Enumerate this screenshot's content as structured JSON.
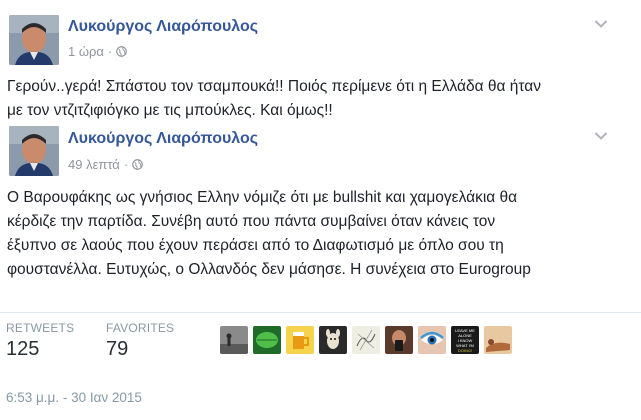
{
  "posts": [
    {
      "author": "Λυκούργος Λιαρόπουλος",
      "time": "1 ώρα",
      "separator": "·",
      "text_lines": [
        "Γερούν..γερά! Σπάστου τον τσαμπουκά!! Ποιός περίμενε ότι η Ελλάδα θα ήταν",
        "με τον ντζιτζιφιόγκο με τις μπούκλες. Και όμως!!"
      ]
    },
    {
      "author": "Λυκούργος Λιαρόπουλος",
      "time": "49 λεπτά",
      "separator": "·",
      "text_lines": [
        "Ο Βαρουφάκης ως γνήσιος Ελλην νόμιζε ότι με bullshit και χαμογελάκια θα",
        "κέρδιζε την παρτίδα. Συνέβη αυτό που πάντα συμβαίνει όταν κάνεις τον",
        "έξυπνο σε λαούς που έχουν περάσει από το Διαφωτισμό με όπλο σου τη",
        "φουστανέλλα. Ευτυχώς, ο Ολλανδός δεν μάσησε. Η συνέχεια στο Eurogroup"
      ]
    }
  ],
  "stats": {
    "retweets_label": "RETWEETS",
    "retweets_value": "125",
    "favorites_label": "FAVORITES",
    "favorites_value": "79"
  },
  "favoriters": [
    {
      "icon": "avatar-silhouette-fog",
      "color": "#6b6b6b"
    },
    {
      "icon": "avatar-green-leaf",
      "color": "#2f8a3a"
    },
    {
      "icon": "avatar-beer-mug",
      "color": "#e0a21c"
    },
    {
      "icon": "avatar-llama",
      "color": "#3a3a3a"
    },
    {
      "icon": "avatar-sketch",
      "color": "#d8d8c8"
    },
    {
      "icon": "avatar-phone-photo",
      "color": "#6a3b2a"
    },
    {
      "icon": "avatar-eye-makeup",
      "color": "#2a6fb8"
    },
    {
      "icon": "avatar-text-poster",
      "color": "#1a1a1a"
    },
    {
      "icon": "avatar-reclining-figure",
      "color": "#c98a5a"
    }
  ],
  "favoriters_text": {
    "text-poster": [
      "LEAVE ME",
      "ALONE",
      "I KNOW",
      "WHAT I'M",
      "DOING!"
    ]
  },
  "timestamp": "6:53 μ.μ. - 30 Ιαν 2015",
  "colors": {
    "author_link": "#365899",
    "meta_gray": "#90949c",
    "twitter_gray": "#8899a6"
  }
}
